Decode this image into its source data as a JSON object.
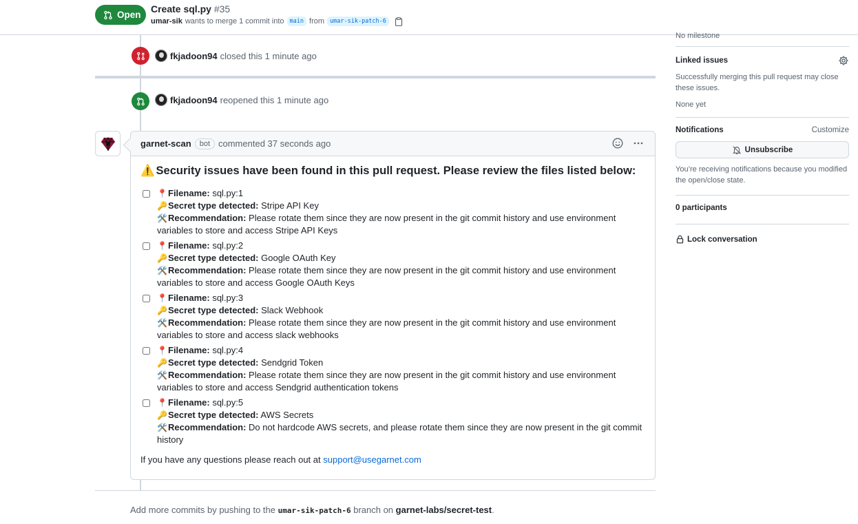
{
  "header": {
    "status": "Open",
    "title": "Create sql.py",
    "number": "#35",
    "author": "umar-sik",
    "merge_text": "wants to merge 1 commit into",
    "base_branch": "main",
    "from_text": "from",
    "head_branch": "umar-sik-patch-6"
  },
  "timeline": {
    "closed_event": {
      "user": "fkjadoon94",
      "text": "closed this 1 minute ago"
    },
    "reopened_event": {
      "user": "fkjadoon94",
      "text": "reopened this 1 minute ago"
    }
  },
  "comment": {
    "author": "garnet-scan",
    "badge": "bot",
    "time": "commented 37 seconds ago",
    "warning_emoji": "⚠️",
    "warning_title": "Security issues have been found in this pull request. Please review the files listed below:",
    "labels": {
      "filename": "Filename:",
      "secret_type": "Secret type detected:",
      "recommendation": "Recommendation:"
    },
    "emojis": {
      "pin": "📍",
      "key": "🔑",
      "tools": "🛠️"
    },
    "findings": [
      {
        "filename": "sql.py:1",
        "secret_type": "Stripe API Key",
        "recommendation": "Please rotate them since they are now present in the git commit history and use environment variables to store and access Stripe API Keys"
      },
      {
        "filename": "sql.py:2",
        "secret_type": "Google OAuth Key",
        "recommendation": "Please rotate them since they are now present in the git commit history and use environment variables to store and access Google OAuth Keys"
      },
      {
        "filename": "sql.py:3",
        "secret_type": "Slack Webhook",
        "recommendation": "Please rotate them since they are now present in the git commit history and use environment variables to store and access slack webhooks"
      },
      {
        "filename": "sql.py:4",
        "secret_type": "Sendgrid Token",
        "recommendation": "Please rotate them since they are now present in the git commit history and use environment variables to store and access Sendgrid authentication tokens"
      },
      {
        "filename": "sql.py:5",
        "secret_type": "AWS Secrets",
        "recommendation": "Do not hardcode AWS secrets, and please rotate them since they are now present in the git commit history"
      }
    ],
    "footer_text": "If you have any questions please reach out at",
    "footer_link": "support@usegarnet.com"
  },
  "bottom_note": {
    "prefix": "Add more commits by pushing to the",
    "branch": "umar-sik-patch-6",
    "middle": "branch on",
    "repo": "garnet-labs/secret-test",
    "suffix": "."
  },
  "sidebar": {
    "milestone": "No milestone",
    "linked_issues": {
      "heading": "Linked issues",
      "description": "Successfully merging this pull request may close these issues.",
      "value": "None yet"
    },
    "notifications": {
      "heading": "Notifications",
      "customize": "Customize",
      "button": "Unsubscribe",
      "description": "You’re receiving notifications because you modified the open/close state."
    },
    "participants": "0 participants",
    "lock": "Lock conversation"
  },
  "colors": {
    "open_green": "#1f883d",
    "closed_red": "#cf222e",
    "link_blue": "#0969da",
    "bot_avatar": "#8b1538"
  }
}
